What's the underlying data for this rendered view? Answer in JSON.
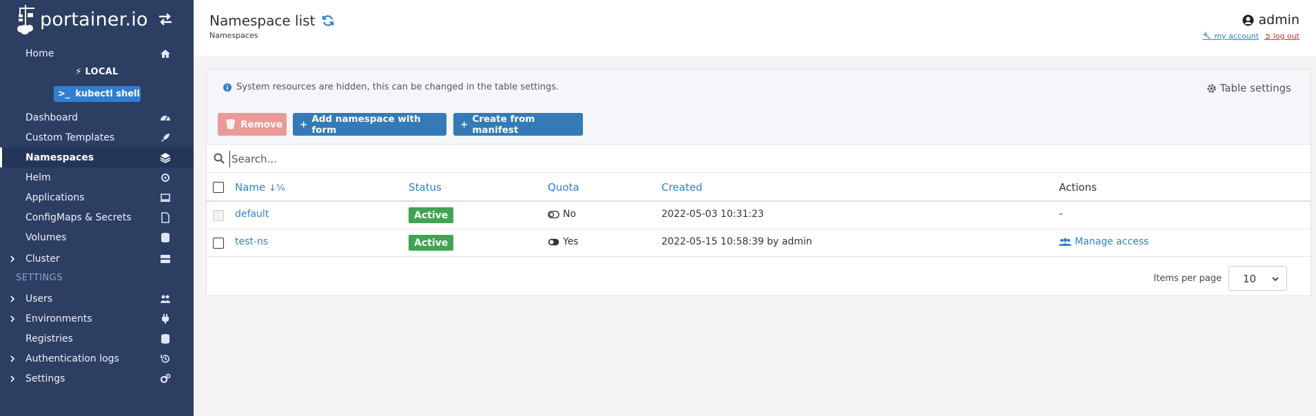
{
  "sidebar": {
    "logo_text": "portainer.io",
    "items": [
      {
        "label": "Home"
      },
      {
        "label": "Dashboard"
      },
      {
        "label": "Custom Templates"
      },
      {
        "label": "Namespaces"
      },
      {
        "label": "Helm"
      },
      {
        "label": "Applications"
      },
      {
        "label": "ConfigMaps & Secrets"
      },
      {
        "label": "Volumes"
      },
      {
        "label": "Cluster"
      },
      {
        "label": "Users"
      },
      {
        "label": "Environments"
      },
      {
        "label": "Registries"
      },
      {
        "label": "Authentication logs"
      },
      {
        "label": "Settings"
      }
    ],
    "environment_name": "LOCAL",
    "shell_button_label": "kubectl shell",
    "settings_section_title": "SETTINGS"
  },
  "header": {
    "title": "Namespace list",
    "breadcrumb": "Namespaces",
    "username": "admin",
    "my_account_label": " my account",
    "logout_label": " log out"
  },
  "panel": {
    "info_text": "System resources are hidden, this can be changed in the table settings.",
    "table_settings_label": "Table settings",
    "buttons": {
      "remove": "Remove",
      "add_namespace": "Add namespace with form",
      "create_manifest": "Create from manifest"
    },
    "search_placeholder": "Search...",
    "columns": {
      "name": "Name",
      "status": "Status",
      "quota": "Quota",
      "created": "Created",
      "actions": "Actions"
    },
    "rows": [
      {
        "name": "default",
        "status": "Active",
        "quota": "No",
        "created": "2022-05-03 10:31:23",
        "actions": "-"
      },
      {
        "name": "test-ns",
        "status": "Active",
        "quota": "Yes",
        "created": "2022-05-15 10:58:39 by admin",
        "actions": "Manage access"
      }
    ],
    "items_per_page_label": "Items per page",
    "items_per_page_value": "10"
  },
  "colors": {
    "sidebar_bg": "#2d3e63",
    "primary": "#337ab7",
    "danger_light": "#eb9b97",
    "success": "#3fa553"
  }
}
